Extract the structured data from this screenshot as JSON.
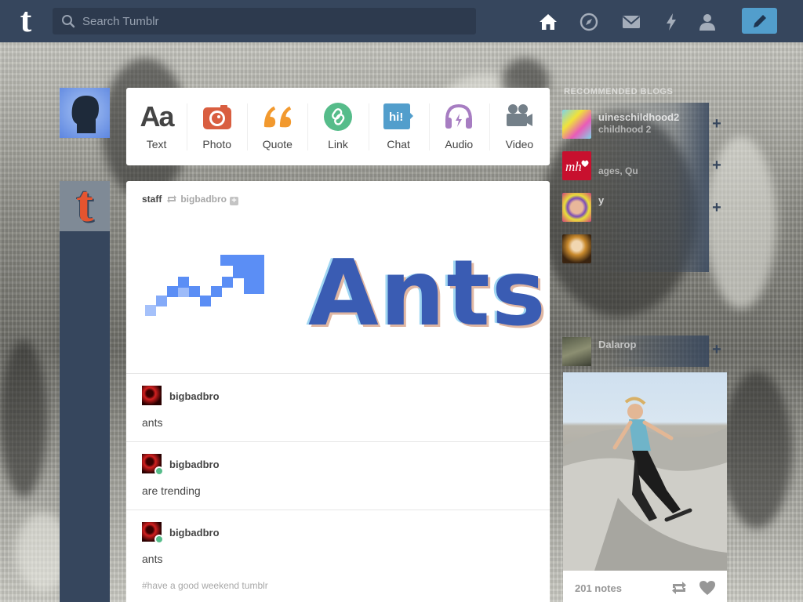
{
  "topbar": {
    "logo": "t",
    "search_placeholder": "Search Tumblr",
    "icons": [
      "home-icon",
      "explore-icon",
      "inbox-icon",
      "activity-icon",
      "account-icon",
      "compose-icon"
    ]
  },
  "post_types": [
    {
      "label": "Text",
      "icon": "text-icon",
      "color": "#444444"
    },
    {
      "label": "Photo",
      "icon": "camera-icon",
      "color": "#d95e40"
    },
    {
      "label": "Quote",
      "icon": "quote-icon",
      "color": "#f2992e"
    },
    {
      "label": "Link",
      "icon": "link-icon",
      "color": "#56bc8a"
    },
    {
      "label": "Chat",
      "icon": "chat-icon",
      "color": "#529ecc"
    },
    {
      "label": "Audio",
      "icon": "headphones-icon",
      "color": "#a77dc2"
    },
    {
      "label": "Video",
      "icon": "video-camera-icon",
      "color": "#748089"
    }
  ],
  "post": {
    "author": "staff",
    "reblogged_from": "bigbadbro",
    "art_text": "Ants",
    "reblogs": [
      {
        "name": "bigbadbro",
        "text": "ants"
      },
      {
        "name": "bigbadbro",
        "text": "are trending"
      },
      {
        "name": "bigbadbro",
        "text": "ants"
      }
    ],
    "tag": "#have a good weekend tumblr"
  },
  "sidebar": {
    "recommended_title": "RECOMMENDED BLOGS",
    "recommended": [
      {
        "name": "uineschildhood2",
        "subtitle": "childhood 2"
      },
      {
        "name": "",
        "subtitle": "ages, Qu"
      },
      {
        "name": "y",
        "subtitle": ""
      },
      {
        "name": "",
        "subtitle": ""
      }
    ],
    "radar": {
      "name": "Dalarop",
      "notes": "201 notes"
    }
  },
  "colors": {
    "navy": "#36465d",
    "accent_blue": "#529ecc",
    "ants_blue": "#3a5cb3"
  }
}
